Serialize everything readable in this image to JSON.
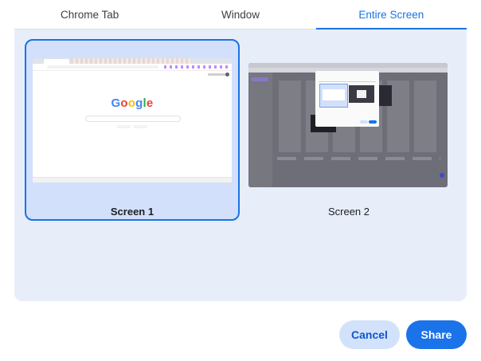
{
  "tabs": [
    {
      "label": "Chrome Tab",
      "active": false
    },
    {
      "label": "Window",
      "active": false
    },
    {
      "label": "Entire Screen",
      "active": true
    }
  ],
  "screens": [
    {
      "label": "Screen 1",
      "selected": true
    },
    {
      "label": "Screen 2",
      "selected": false
    }
  ],
  "thumbnail_1": {
    "logo_text": "Google"
  },
  "actions": {
    "cancel_label": "Cancel",
    "share_label": "Share"
  },
  "colors": {
    "accent": "#1a73e8",
    "panel_bg": "#e8eef9",
    "selected_card_bg": "#d2e0fb",
    "cancel_bg": "#d3e2fb"
  }
}
